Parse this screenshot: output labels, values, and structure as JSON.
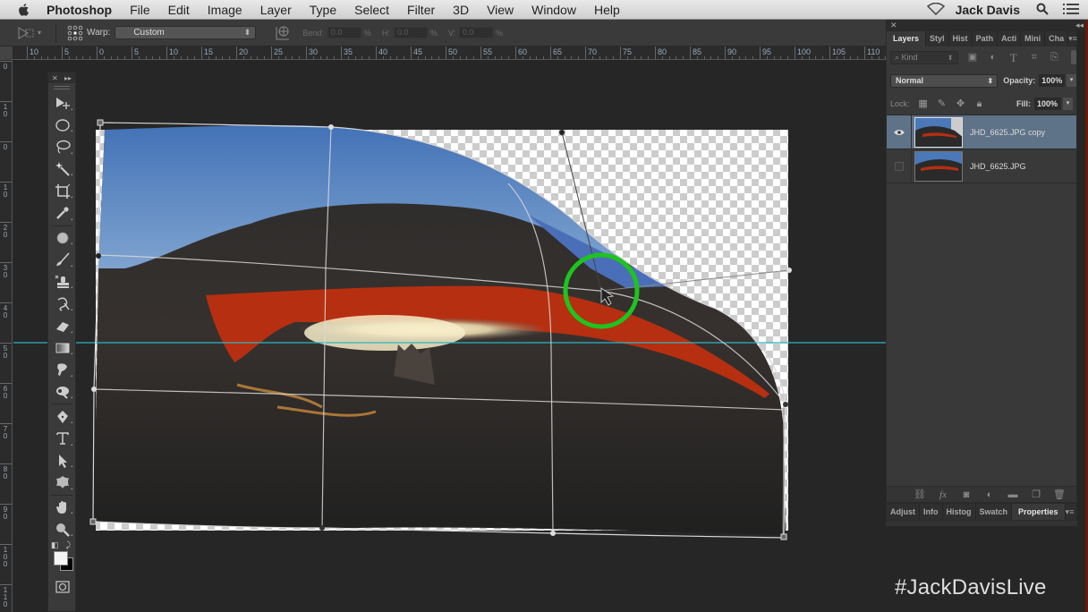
{
  "menubar": {
    "app_name": "Photoshop",
    "items": [
      "File",
      "Edit",
      "Image",
      "Layer",
      "Type",
      "Select",
      "Filter",
      "3D",
      "View",
      "Window",
      "Help"
    ],
    "user_name": "Jack Davis",
    "icons": [
      "apple-icon",
      "wifi-icon",
      "search-icon",
      "list-icon"
    ]
  },
  "options_bar": {
    "warp_label": "Warp:",
    "warp_value": "Custom",
    "bend_label": "Bend:",
    "bend_value": "0.0",
    "h_label": "H:",
    "h_value": "0.0",
    "v_label": "V:",
    "v_value": "0.0",
    "percent": "%"
  },
  "rulers": {
    "horizontal_labels": [
      "10",
      "5",
      "0",
      "5",
      "10",
      "15",
      "20",
      "25",
      "30",
      "35",
      "40",
      "45",
      "50",
      "55",
      "60",
      "65",
      "70",
      "75",
      "80",
      "85",
      "90",
      "95",
      "100",
      "105",
      "110"
    ],
    "vertical_labels": [
      "0",
      "10",
      "0",
      "10",
      "20",
      "30",
      "40",
      "50",
      "60",
      "70",
      "80",
      "90",
      "100",
      "110"
    ]
  },
  "tools_panel": {
    "tools": [
      "move-tool",
      "elliptical-marquee-tool",
      "lasso-tool",
      "magic-wand-tool",
      "crop-tool",
      "eyedropper-tool",
      "spot-healing-tool",
      "brush-tool",
      "clone-stamp-tool",
      "history-brush-tool",
      "eraser-tool",
      "gradient-tool",
      "smudge-tool",
      "dodge-tool",
      "pen-tool",
      "type-tool",
      "path-selection-tool",
      "custom-shape-tool",
      "hand-tool",
      "zoom-tool"
    ],
    "foreground_color": "#f4f4f4",
    "background_color": "#000000"
  },
  "layers_panel": {
    "tabs": [
      "Layers",
      "Styl",
      "Hist",
      "Path",
      "Acti",
      "Mini",
      "Cha"
    ],
    "active_tab": "Layers",
    "filter_kind": "Kind",
    "blend_mode": "Normal",
    "opacity_label": "Opacity:",
    "opacity_value": "100%",
    "lock_label": "Lock:",
    "fill_label": "Fill:",
    "fill_value": "100%",
    "layers": [
      {
        "name": "JHD_6625.JPG copy",
        "visible": true,
        "selected": true
      },
      {
        "name": "JHD_6625.JPG",
        "visible": false,
        "selected": false
      }
    ]
  },
  "bottom_panel": {
    "tabs": [
      "Adjust",
      "Info",
      "Histog",
      "Swatch",
      "Properties"
    ],
    "active_tab": "Properties"
  },
  "canvas": {
    "guide_color": "#2ab7c4",
    "highlight_ring_color": "#1ec41e"
  },
  "overlay": {
    "hashtag": "#JackDavisLive"
  }
}
